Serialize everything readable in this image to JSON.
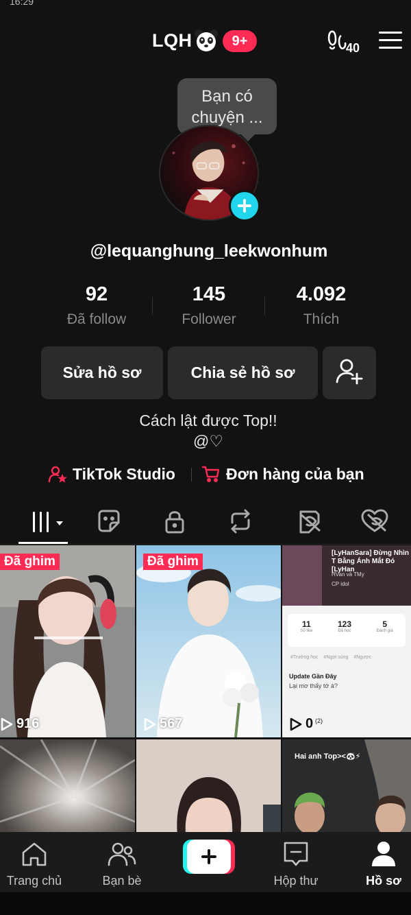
{
  "status_bar": {
    "time": "16:29"
  },
  "header": {
    "title": "LQH",
    "notification_badge": "9+",
    "steps_count": "40"
  },
  "profile": {
    "note_bubble": "Bạn có chuyện ...",
    "username": "@lequanghung_leekwonhum",
    "stats": [
      {
        "value": "92",
        "label": "Đã follow"
      },
      {
        "value": "145",
        "label": "Follower"
      },
      {
        "value": "4.092",
        "label": "Thích"
      }
    ],
    "actions": {
      "edit": "Sửa hồ sơ",
      "share": "Chia sẻ hồ sơ"
    },
    "bio_line1": "Cách lật được Top!!",
    "bio_line2": "@♡",
    "links": {
      "studio": "TikTok Studio",
      "orders": "Đơn hàng của bạn"
    }
  },
  "tabs": [
    "videos",
    "favorites",
    "private",
    "reposts",
    "hidden",
    "liked"
  ],
  "videos": [
    {
      "pinned": "Đã ghim",
      "views": "916"
    },
    {
      "pinned": "Đã ghim",
      "views": "567"
    },
    {
      "views": "0",
      "overlay_title": "[LyHanSara] Đừng Nhìn T Bằng Ánh Mắt Đó [LyHan",
      "overlay_sub1": "HVan và TMy",
      "overlay_sub2": "CP idol",
      "overlay_stats": [
        "11",
        "123",
        "5"
      ],
      "overlay_stat_labels": [
        "Số like",
        "Đã học",
        "Đánh giá"
      ],
      "overlay_tags": [
        "#Trường học",
        "#Ngọt sủng",
        "#Ngược"
      ],
      "overlay_update": "Update Gần Đây",
      "overlay_question": "Lại mơ thấy tớ à?",
      "overlay_chapter": "(2)"
    },
    {},
    {},
    {
      "overlay_title": "Hai anh Top><🐼⚡"
    }
  ],
  "bottom_nav": {
    "home": "Trang chủ",
    "friends": "Bạn bè",
    "inbox": "Hộp thư",
    "profile": "Hồ sơ"
  },
  "colors": {
    "accent": "#fe2c55",
    "cyan": "#25f4ee",
    "background": "#121212"
  }
}
